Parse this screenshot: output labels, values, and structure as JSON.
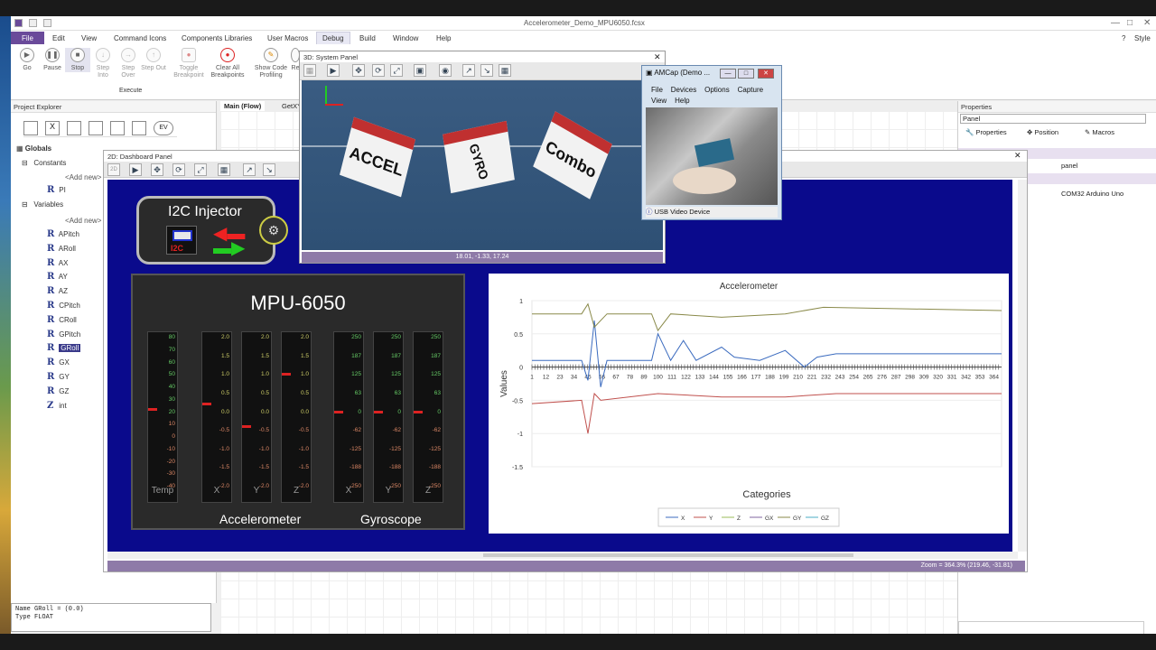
{
  "window": {
    "title": "Accelerometer_Demo_MPU6050.fcsx",
    "style_label": "Style"
  },
  "menu": [
    "File",
    "Edit",
    "View",
    "Command Icons",
    "Components Libraries",
    "User Macros",
    "Debug",
    "Build",
    "Window",
    "Help"
  ],
  "ribbon": {
    "buttons": [
      {
        "label": "Go",
        "icon": "play-icon"
      },
      {
        "label": "Pause",
        "icon": "pause-icon"
      },
      {
        "label": "Stop",
        "icon": "stop-icon"
      },
      {
        "label": "Step Into",
        "icon": "step-into-icon"
      },
      {
        "label": "Step Over",
        "icon": "step-over-icon"
      },
      {
        "label": "Step Out",
        "icon": "step-out-icon"
      },
      {
        "label": "Toggle Breakpoint",
        "icon": "breakpoint-icon"
      },
      {
        "label": "Clear All Breakpoints",
        "icon": "clear-breakpoints-icon"
      },
      {
        "label": "Show Code Profiling",
        "icon": "pencil-icon"
      },
      {
        "label": "Re",
        "icon": "re-icon"
      }
    ],
    "group_label": "Execute"
  },
  "project_explorer": {
    "title": "Project Explorer",
    "globals": "Globals",
    "constants": "Constants",
    "add_new": "<Add new>",
    "const_items": [
      "PI"
    ],
    "variables": "Variables",
    "var_items": [
      "APitch",
      "ARoll",
      "AX",
      "AY",
      "AZ",
      "CPitch",
      "CRoll",
      "GPitch",
      "GRoll",
      "GX",
      "GY",
      "GZ",
      "int"
    ],
    "selected": "GRoll"
  },
  "propbox": {
    "line1": "Name GRoll = (0.0)",
    "line2": "Type FLOAT"
  },
  "tabs": {
    "main": "Main (Flow)",
    "second": "GetXYZ"
  },
  "properties": {
    "title": "Properties",
    "search": "Panel",
    "tab_props": "Properties",
    "tab_position": "Position",
    "tab_macros": "Macros",
    "value1": "panel",
    "value2": "COM32 Arduino Uno"
  },
  "dashboard": {
    "title": "2D: Dashboard Panel",
    "zoom_status": "Zoom = 364.3% (219.46, -31.81)",
    "tb_2d": "2D"
  },
  "i2c": {
    "label": "I2C Injector",
    "chip": "I2C"
  },
  "mpu": {
    "title": "MPU-6050",
    "temp_scale": [
      "80",
      "70",
      "60",
      "50",
      "40",
      "30",
      "20",
      "10",
      "0",
      "-10",
      "-20",
      "-30",
      "-40"
    ],
    "acc_scale": [
      "2.0",
      "1.5",
      "1.0",
      "0.5",
      "0.0",
      "-0.5",
      "-1.0",
      "-1.5",
      "-2.0"
    ],
    "gyro_scale": [
      "250",
      "187",
      "125",
      "63",
      "0",
      "-62",
      "-125",
      "-188",
      "-250"
    ],
    "temp_cap": "Temp",
    "acc_caps": [
      "X",
      "Y",
      "Z"
    ],
    "gyro_caps": [
      "X",
      "Y",
      "Z"
    ],
    "acc_label": "Accelerometer",
    "gyro_label": "Gyroscope",
    "needles": {
      "temp": 22,
      "acc_x": 0.2,
      "acc_y": -0.4,
      "acc_z": 1.0,
      "gyro_x": 0,
      "gyro_y": 0,
      "gyro_z": 0
    }
  },
  "chart_data": {
    "type": "line",
    "title": "Accelerometer",
    "xlabel": "Categories",
    "ylabel": "Values",
    "ylim": [
      -1.5,
      1
    ],
    "yticks": [
      "1",
      "0.5",
      "0",
      "-0.5",
      "-1",
      "-1.5"
    ],
    "xticks": [
      "1",
      "12",
      "23",
      "34",
      "45",
      "56",
      "67",
      "78",
      "89",
      "100",
      "111",
      "122",
      "133",
      "144",
      "155",
      "166",
      "177",
      "188",
      "199",
      "210",
      "221",
      "232",
      "243",
      "254",
      "265",
      "276",
      "287",
      "298",
      "309",
      "320",
      "331",
      "342",
      "353",
      "364"
    ],
    "xlim": [
      1,
      370
    ],
    "legend_position": "bottom",
    "series": [
      {
        "name": "X",
        "color": "#3b6bbf",
        "points": [
          [
            1,
            0.1
          ],
          [
            40,
            0.1
          ],
          [
            45,
            -0.2
          ],
          [
            50,
            0.7
          ],
          [
            55,
            -0.3
          ],
          [
            60,
            0.1
          ],
          [
            95,
            0.1
          ],
          [
            100,
            0.5
          ],
          [
            110,
            0.1
          ],
          [
            120,
            0.4
          ],
          [
            130,
            0.1
          ],
          [
            150,
            0.3
          ],
          [
            160,
            0.15
          ],
          [
            180,
            0.1
          ],
          [
            200,
            0.25
          ],
          [
            215,
            0.0
          ],
          [
            225,
            0.15
          ],
          [
            240,
            0.2
          ],
          [
            370,
            0.2
          ]
        ]
      },
      {
        "name": "Y",
        "color": "#c0504d",
        "points": [
          [
            1,
            -0.55
          ],
          [
            40,
            -0.5
          ],
          [
            45,
            -1.0
          ],
          [
            50,
            -0.4
          ],
          [
            55,
            -0.5
          ],
          [
            100,
            -0.4
          ],
          [
            150,
            -0.45
          ],
          [
            200,
            -0.45
          ],
          [
            240,
            -0.4
          ],
          [
            370,
            -0.4
          ]
        ]
      },
      {
        "name": "GY",
        "color": "#8a8a4a",
        "points": [
          [
            1,
            0.8
          ],
          [
            40,
            0.8
          ],
          [
            45,
            0.95
          ],
          [
            50,
            0.6
          ],
          [
            60,
            0.8
          ],
          [
            95,
            0.8
          ],
          [
            100,
            0.55
          ],
          [
            110,
            0.8
          ],
          [
            150,
            0.75
          ],
          [
            200,
            0.8
          ],
          [
            230,
            0.9
          ],
          [
            370,
            0.85
          ]
        ]
      }
    ],
    "legend": [
      "X",
      "Y",
      "Z",
      "GX",
      "GY",
      "GZ"
    ]
  },
  "panel3d": {
    "title": "3D: System Panel",
    "coords": "18.01, -1.33, 17.24",
    "cubes": [
      "ACCEL",
      "GYRO",
      "Combo"
    ]
  },
  "amcap": {
    "title": "AMCap (Demo ...",
    "menu1": [
      "File",
      "Devices",
      "Options",
      "Capture"
    ],
    "menu2": [
      "View",
      "Help"
    ],
    "status": "USB Video Device"
  }
}
